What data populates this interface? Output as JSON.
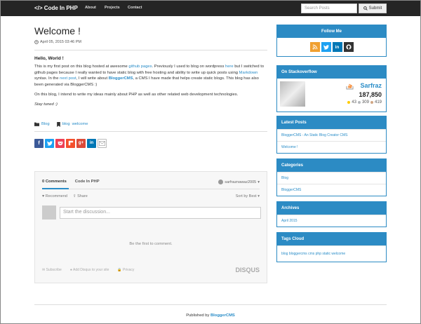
{
  "nav": {
    "brand": "</> Code In PHP",
    "links": [
      "About",
      "Projects",
      "Contact"
    ],
    "search_placeholder": "Search Posts",
    "submit": "Submit"
  },
  "post": {
    "title": "Welcome !",
    "date": "April 05, 2015 03:46 PM",
    "greeting": "Hello, World !",
    "para1_a": "This is my first post on this blog hosted at awesome ",
    "para1_link1": "github pages",
    "para1_b": ". Previously I used to blog on wordpress ",
    "para1_link2": "here",
    "para1_c": " but I switched to github pages because I really wanted to have static blog with free hosting and ability to write up quick posts using ",
    "para1_link3": "Markdown",
    "para1_d": " syntax. In the ",
    "para1_link4": "next post",
    "para1_e": ", I will write about ",
    "para1_link5": "BloggerCMS",
    "para1_f": ", a CMS I have made that helps create static blogs. This blog has also been generated via BloggerCMS :)",
    "para2": "On this blog, I intend to write my ideas mainly about PHP as well as other related web development technologies.",
    "stay": "Stay tuned :)",
    "category": "Blog",
    "tags": [
      "blog",
      "welcome"
    ]
  },
  "disqus": {
    "tab_comments": "0 Comments",
    "tab_site": "Code In PHP",
    "user": "sarfraznawaz2005",
    "recommend": "Recommend",
    "share": "Share",
    "sort": "Sort by Best",
    "placeholder": "Start the discussion...",
    "empty": "Be the first to comment.",
    "subscribe": "Subscribe",
    "add_disqus": "Add Disqus to your site",
    "privacy": "Privacy",
    "logo": "DISQUS"
  },
  "sidebar": {
    "follow_title": "Follow Me",
    "so_title": "On Stackoverflow",
    "so_name": "Sarfraz",
    "so_rep": "187,850",
    "so_gold": "43",
    "so_silver": "309",
    "so_bronze": "419",
    "latest_title": "Latest Posts",
    "latest": [
      "BloggerCMS - An Static Blog Creator CMS",
      "Welcome !"
    ],
    "categories_title": "Categories",
    "categories": [
      "Blog",
      "BloggerCMS"
    ],
    "archives_title": "Archives",
    "archives": [
      "April 2015"
    ],
    "tags_title": "Tags Cloud",
    "tags_text": "blog bloggercms cms php static welcome"
  },
  "footer": {
    "text": "Published by ",
    "link": "BloggerCMS"
  },
  "colors": {
    "accent": "#2c8bc4",
    "navbar": "#252525"
  }
}
